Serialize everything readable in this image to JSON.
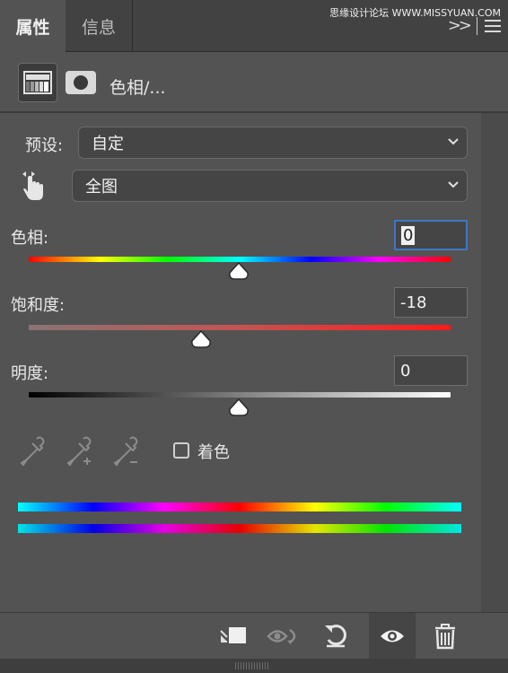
{
  "tabs": [
    {
      "label": "属性",
      "active": true
    },
    {
      "label": "信息",
      "active": false
    }
  ],
  "watermark": "思缘设计论坛 WWW.MISSYUAN.COM",
  "adjustment": {
    "title": "色相/...",
    "icon_names": [
      "hue-saturation-adjustment-icon",
      "layer-mask-icon"
    ]
  },
  "preset": {
    "label": "预设:",
    "value": "自定"
  },
  "channel": {
    "value": "全图",
    "icon": "targeted-adjustment-hand-icon"
  },
  "hue": {
    "label": "色相:",
    "value": "0",
    "min": -180,
    "max": 180
  },
  "saturation": {
    "label": "饱和度:",
    "value": "-18",
    "min": -100,
    "max": 100
  },
  "lightness": {
    "label": "明度:",
    "value": "0",
    "min": -100,
    "max": 100
  },
  "eyedroppers": [
    "eyedropper-icon",
    "eyedropper-add-icon",
    "eyedropper-subtract-icon"
  ],
  "colorize": {
    "label": "着色",
    "checked": false
  },
  "footer_icons": [
    "clip-to-layer-icon",
    "view-previous-state-icon",
    "reset-icon",
    "visibility-eye-icon",
    "trash-icon"
  ],
  "colors": {
    "panel_bg": "#535353",
    "tab_bar_bg": "#424242",
    "focus_border": "#3d77c2",
    "text": "#e8e8e8"
  }
}
